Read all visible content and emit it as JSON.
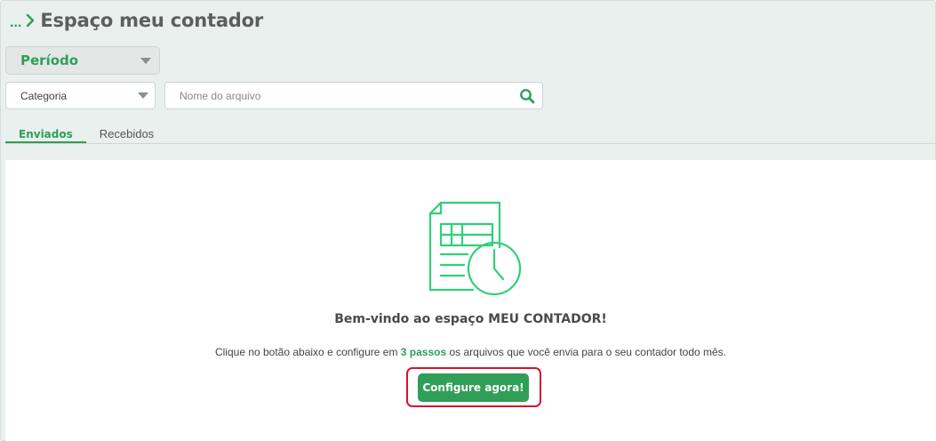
{
  "header": {
    "breadcrumb_ellipsis": "...",
    "title": "Espaço meu contador"
  },
  "filters": {
    "periodo_label": "Período",
    "categoria_label": "Categoria",
    "search_placeholder": "Nome do arquivo",
    "search_value": ""
  },
  "tabs": [
    {
      "label": "Enviados",
      "active": true
    },
    {
      "label": "Recebidos",
      "active": false
    }
  ],
  "main": {
    "welcome": "Bem-vindo ao espaço MEU CONTADOR!",
    "desc_before": "Clique no botão abaixo e configure em ",
    "desc_highlight": "3 passos",
    "desc_after": " os arquivos que você envia para o seu contador todo mês.",
    "cta_label": "Configure agora!"
  },
  "colors": {
    "accent": "#2f9e57",
    "illustration": "#2fd07a",
    "highlight_outline": "#d3132f",
    "background": "#e9f0ee"
  },
  "icons": [
    "chevron-right-icon",
    "caret-down-icon",
    "search-icon",
    "spreadsheet-clock-icon"
  ]
}
